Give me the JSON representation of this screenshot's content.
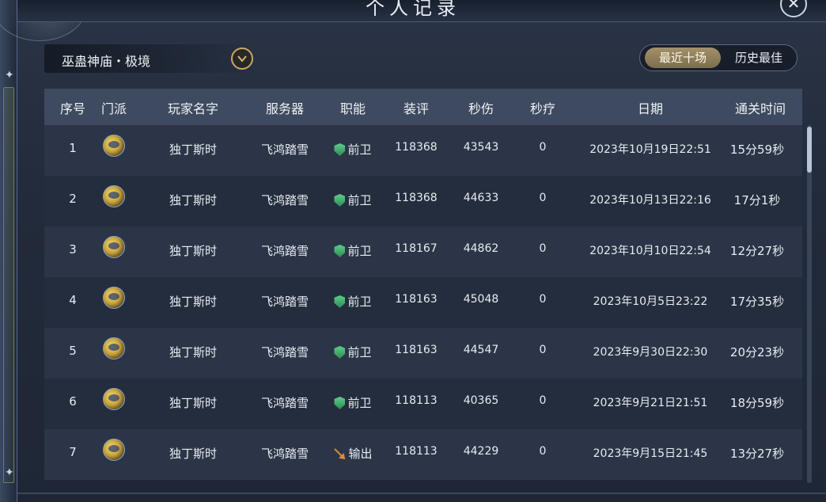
{
  "window": {
    "title": "个人记录"
  },
  "dungeon": {
    "name": "巫蛊神庙・极境"
  },
  "tabs": {
    "recent": "最近十场",
    "best": "历史最佳"
  },
  "table": {
    "headers": {
      "index": "序号",
      "sect": "门派",
      "player": "玩家名字",
      "server": "服务器",
      "role": "职能",
      "score": "装评",
      "dps": "秒伤",
      "hps": "秒疗",
      "date": "日期",
      "time": "通关时间"
    },
    "rows": [
      {
        "index": "1",
        "sect_icon": "sect-emblem-icon",
        "player": "独丁斯时",
        "server": "飞鸿踏雪",
        "role": "前卫",
        "role_icon": "shield-icon",
        "score": "118368",
        "dps": "43543",
        "hps": "0",
        "date": "2023年10月19日22:51",
        "time": "15分59秒"
      },
      {
        "index": "2",
        "sect_icon": "sect-emblem-icon",
        "player": "独丁斯时",
        "server": "飞鸿踏雪",
        "role": "前卫",
        "role_icon": "shield-icon",
        "score": "118368",
        "dps": "44633",
        "hps": "0",
        "date": "2023年10月13日22:16",
        "time": "17分1秒"
      },
      {
        "index": "3",
        "sect_icon": "sect-emblem-icon",
        "player": "独丁斯时",
        "server": "飞鸿踏雪",
        "role": "前卫",
        "role_icon": "shield-icon",
        "score": "118167",
        "dps": "44862",
        "hps": "0",
        "date": "2023年10月10日22:54",
        "time": "12分27秒"
      },
      {
        "index": "4",
        "sect_icon": "sect-emblem-icon",
        "player": "独丁斯时",
        "server": "飞鸿踏雪",
        "role": "前卫",
        "role_icon": "shield-icon",
        "score": "118163",
        "dps": "45048",
        "hps": "0",
        "date": "2023年10月5日23:22",
        "time": "17分35秒"
      },
      {
        "index": "5",
        "sect_icon": "sect-emblem-icon",
        "player": "独丁斯时",
        "server": "飞鸿踏雪",
        "role": "前卫",
        "role_icon": "shield-icon",
        "score": "118163",
        "dps": "44547",
        "hps": "0",
        "date": "2023年9月30日22:30",
        "time": "20分23秒"
      },
      {
        "index": "6",
        "sect_icon": "sect-emblem-icon",
        "player": "独丁斯时",
        "server": "飞鸿踏雪",
        "role": "前卫",
        "role_icon": "shield-icon",
        "score": "118113",
        "dps": "40365",
        "hps": "0",
        "date": "2023年9月21日21:51",
        "time": "18分59秒"
      },
      {
        "index": "7",
        "sect_icon": "sect-emblem-icon",
        "player": "独丁斯时",
        "server": "飞鸿踏雪",
        "role": "输出",
        "role_icon": "sword-icon",
        "score": "118113",
        "dps": "44229",
        "hps": "0",
        "date": "2023年9月15日21:45",
        "time": "13分27秒"
      }
    ]
  },
  "colors": {
    "accent_gold": "#a3916a",
    "guard_green": "#3fae6c",
    "header_bg": "#3d4a5f",
    "row_odd": "#2b3547",
    "row_even": "#242d3d"
  }
}
